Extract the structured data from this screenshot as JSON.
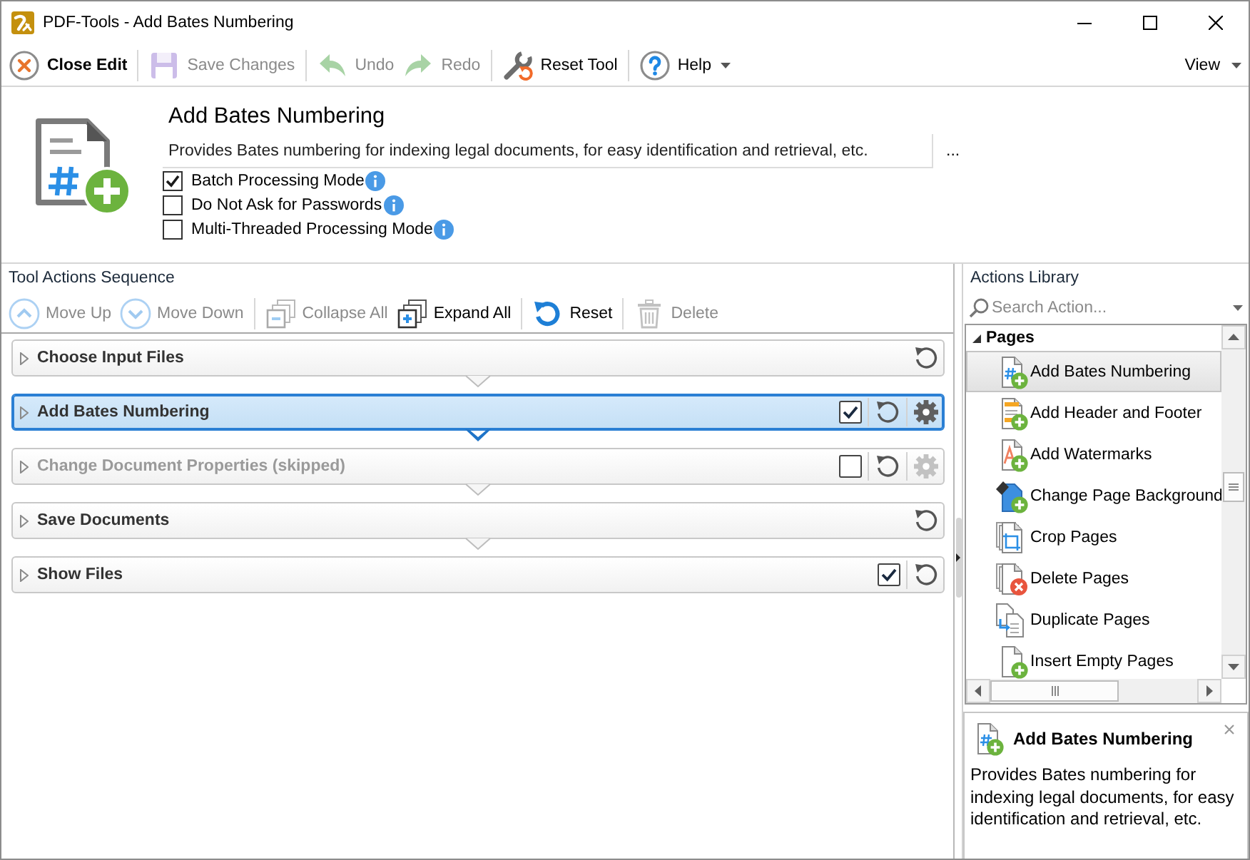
{
  "window": {
    "title": "PDF-Tools - Add Bates Numbering"
  },
  "toolbar": {
    "groups": [
      [
        {
          "kind": "close",
          "label": "Close Edit",
          "disabled": false,
          "dropdown": false
        }
      ],
      [
        {
          "kind": "save",
          "label": "Save Changes",
          "disabled": true,
          "dropdown": false
        }
      ],
      [
        {
          "kind": "undo",
          "label": "Undo",
          "disabled": true,
          "dropdown": false
        },
        {
          "kind": "redo",
          "label": "Redo",
          "disabled": true,
          "dropdown": false
        }
      ],
      [
        {
          "kind": "reset",
          "label": "Reset Tool",
          "disabled": false,
          "dropdown": false
        }
      ],
      [
        {
          "kind": "help",
          "label": "Help",
          "disabled": false,
          "dropdown": true
        }
      ]
    ],
    "view_menu": {
      "label": "View"
    }
  },
  "tool": {
    "title": "Add Bates Numbering",
    "description": "Provides Bates numbering for indexing legal documents, for easy identification and retrieval, etc.",
    "more_button": "...",
    "options": [
      {
        "label": "Batch Processing Mode",
        "checked": true
      },
      {
        "label": "Do Not Ask for Passwords",
        "checked": false
      },
      {
        "label": "Multi-Threaded Processing Mode",
        "checked": false
      }
    ]
  },
  "sequence": {
    "title": "Tool Actions Sequence",
    "toolbar": {
      "groups": [
        [
          {
            "kind": "up",
            "label": "Move Up",
            "disabled": true
          },
          {
            "kind": "down",
            "label": "Move Down",
            "disabled": true
          }
        ],
        [
          {
            "kind": "collapse",
            "label": "Collapse All",
            "disabled": true
          },
          {
            "kind": "expand",
            "label": "Expand All",
            "disabled": false
          }
        ],
        [
          {
            "kind": "reset",
            "label": "Reset",
            "disabled": false
          }
        ],
        [
          {
            "kind": "delete",
            "label": "Delete",
            "disabled": true
          }
        ]
      ]
    },
    "actions": [
      {
        "kind": "source",
        "label": "Choose Input Files",
        "selected": false
      },
      {
        "kind": "action",
        "label": "Add Bates Numbering",
        "selected": true,
        "checked": true
      },
      {
        "kind": "action",
        "label": "Change Document Properties (skipped)",
        "selected": false,
        "checked": false
      },
      {
        "kind": "output",
        "label": "Save Documents",
        "selected": false
      },
      {
        "kind": "viewer",
        "label": "Show Files",
        "selected": false,
        "checked": true
      }
    ]
  },
  "library": {
    "title": "Actions Library",
    "search": {
      "placeholder": "Search Action..."
    },
    "groups": [
      {
        "label": "Pages",
        "expanded": true,
        "children": [
          {
            "kind": "bates",
            "label": "Add Bates Numbering",
            "selected": true
          },
          {
            "kind": "header_footer",
            "label": "Add Header and Footer",
            "selected": false
          },
          {
            "kind": "watermark",
            "label": "Add Watermarks",
            "selected": false
          },
          {
            "kind": "background",
            "label": "Change Page Background",
            "selected": false
          },
          {
            "kind": "crop",
            "label": "Crop Pages",
            "selected": false
          },
          {
            "kind": "delete",
            "label": "Delete Pages",
            "selected": false
          },
          {
            "kind": "duplicate",
            "label": "Duplicate Pages",
            "selected": false
          },
          {
            "kind": "insert",
            "label": "Insert Empty Pages",
            "selected": false
          }
        ]
      }
    ]
  },
  "details": {
    "title": "Add Bates Numbering",
    "description": "Provides Bates numbering for indexing legal documents, for easy identification and retrieval, etc."
  }
}
